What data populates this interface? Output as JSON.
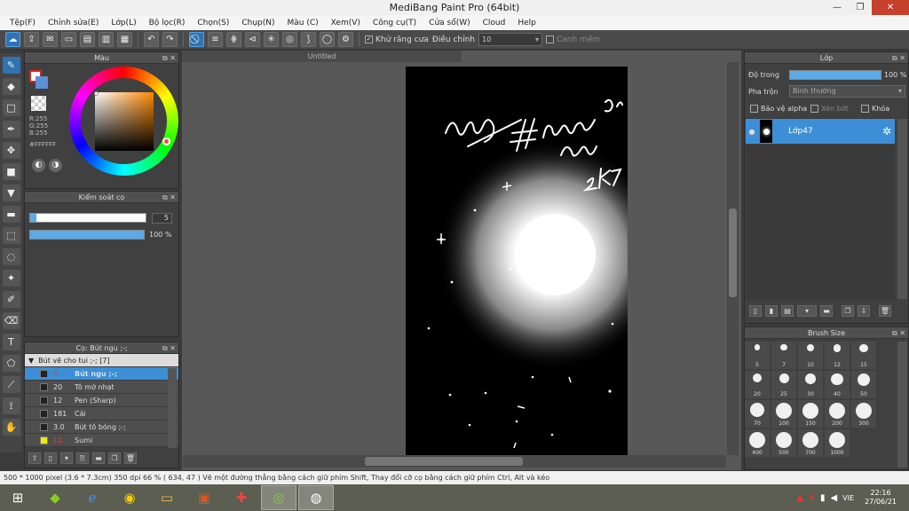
{
  "window": {
    "title": "MediBang Paint Pro (64bit)"
  },
  "menu": [
    "Tệp(F)",
    "Chỉnh sửa(E)",
    "Lớp(L)",
    "Bộ lọc(R)",
    "Chọn(S)",
    "Chụp(N)",
    "Màu (C)",
    "Xem(V)",
    "Công cụ(T)",
    "Cửa sổ(W)",
    "Cloud",
    "Help"
  ],
  "toolbar": {
    "antialias_label": "Khử răng cưa",
    "adjust_label": "Điều chỉnh",
    "adjust_value": "10",
    "edge_label": "Canh mềm"
  },
  "color_panel": {
    "title": "Màu",
    "r": "R:255",
    "g": "G:255",
    "b": "B:255",
    "hex": "#FFFFFF"
  },
  "brush_control": {
    "title": "Kiểm soát cọ",
    "size_value": "5",
    "size_fraction": 0.05,
    "opacity_value": "100 %",
    "opacity_fraction": 1.0
  },
  "brush_panel": {
    "title": "Cọ: Bút ngu ;-;",
    "group": "Bút vẽ cho tui ;-; [7]",
    "items": [
      {
        "size": "5",
        "name": "Bút ngu ;-;",
        "selected": true
      },
      {
        "size": "20",
        "name": "Tô mờ nhạt",
        "selected": false
      },
      {
        "size": "12",
        "name": "Pen (Sharp)",
        "selected": false
      },
      {
        "size": "181",
        "name": "Cái",
        "selected": false
      },
      {
        "size": "3.0",
        "name": "Bút tô bóng ;-;",
        "selected": false
      },
      {
        "size": "12",
        "name": "Sumi",
        "selected": false
      }
    ]
  },
  "canvas": {
    "doc_title": "Untitled"
  },
  "layer_panel": {
    "title": "Lớp",
    "opacity_label": "Độ trong",
    "opacity_value": "100 %",
    "blend_label": "Pha trộn",
    "blend_value": "Bình thường",
    "protect_alpha": "Bảo vệ alpha",
    "clipping": "Xén bớt",
    "lock": "Khóa",
    "layers": [
      {
        "name": "Lớp47"
      }
    ]
  },
  "brush_size_panel": {
    "title": "Brush Size",
    "sizes": [
      "5",
      "7",
      "10",
      "12",
      "15",
      "20",
      "25",
      "30",
      "40",
      "50",
      "70",
      "100",
      "150",
      "200",
      "300",
      "400",
      "500",
      "700",
      "1000"
    ]
  },
  "status": {
    "text": "500 * 1000 pixel   (3.6 * 7.3cm)   350 dpi   66 %   ( 634, 47 )   Vẽ một đường thẳng bằng cách giữ phím Shift, Thay đổi cỡ cọ bằng cách giữ phím Ctrl, Alt và kéo"
  },
  "taskbar": {
    "lang": "VIE",
    "time": "22:16",
    "date": "27/06/21"
  },
  "colors": {
    "accent": "#3c8fd6",
    "panel_bg": "#404040",
    "foreground": "#FFFFFF",
    "background": "#000000"
  }
}
